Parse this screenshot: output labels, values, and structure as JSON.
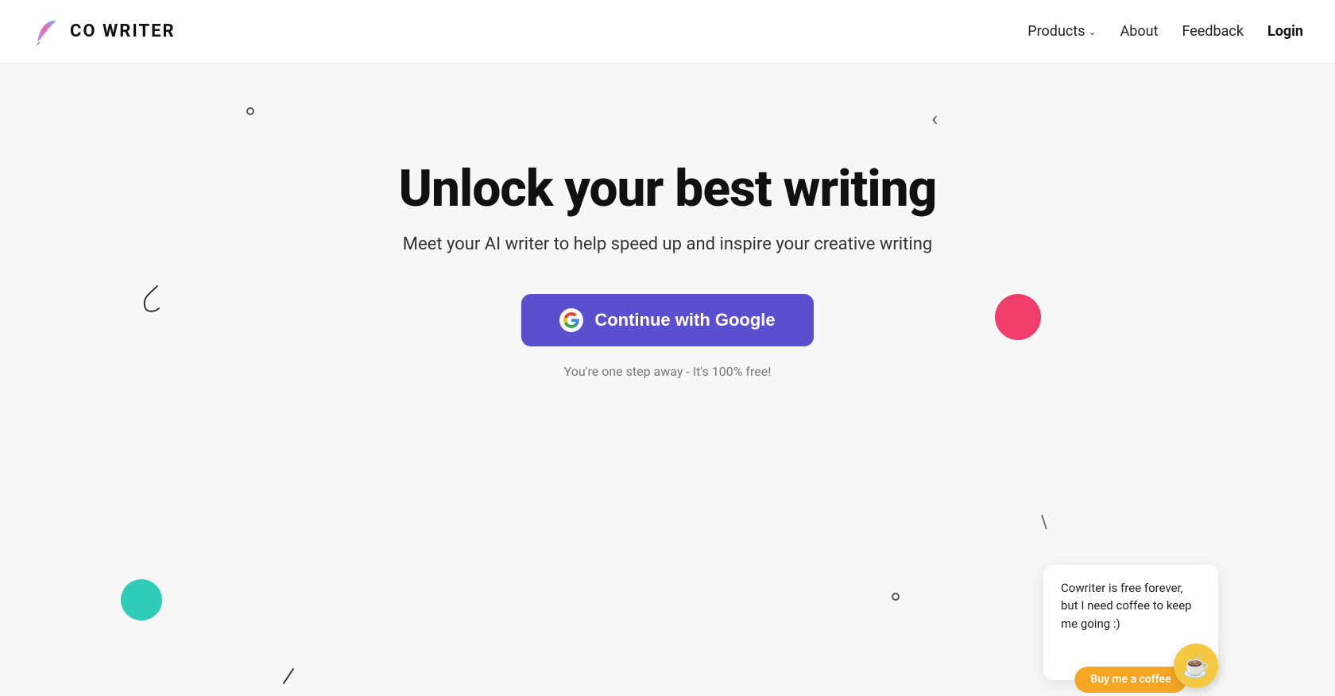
{
  "header": {
    "logo_text": "CO WRITER",
    "nav": {
      "products_label": "Products",
      "about_label": "About",
      "feedback_label": "Feedback",
      "login_label": "Login"
    }
  },
  "hero": {
    "title": "Unlock your best writing",
    "subtitle": "Meet your AI writer to help speed up and inspire your creative writing",
    "google_btn_label": "Continue with Google",
    "google_btn_icon_letter": "G",
    "free_text": "You're one step away - It's 100% free!"
  },
  "coffee_popup": {
    "text": "Cowriter is free forever, but I need coffee to keep me going :)",
    "action_label": "Buy me a coffee"
  },
  "colors": {
    "button_bg": "#5b4fcf",
    "pink_circle": "#f03d6c",
    "green_circle": "#2fcdb8",
    "coffee_btn": "#f5c842"
  },
  "icons": {
    "chevron": "›",
    "coffee": "☕"
  }
}
